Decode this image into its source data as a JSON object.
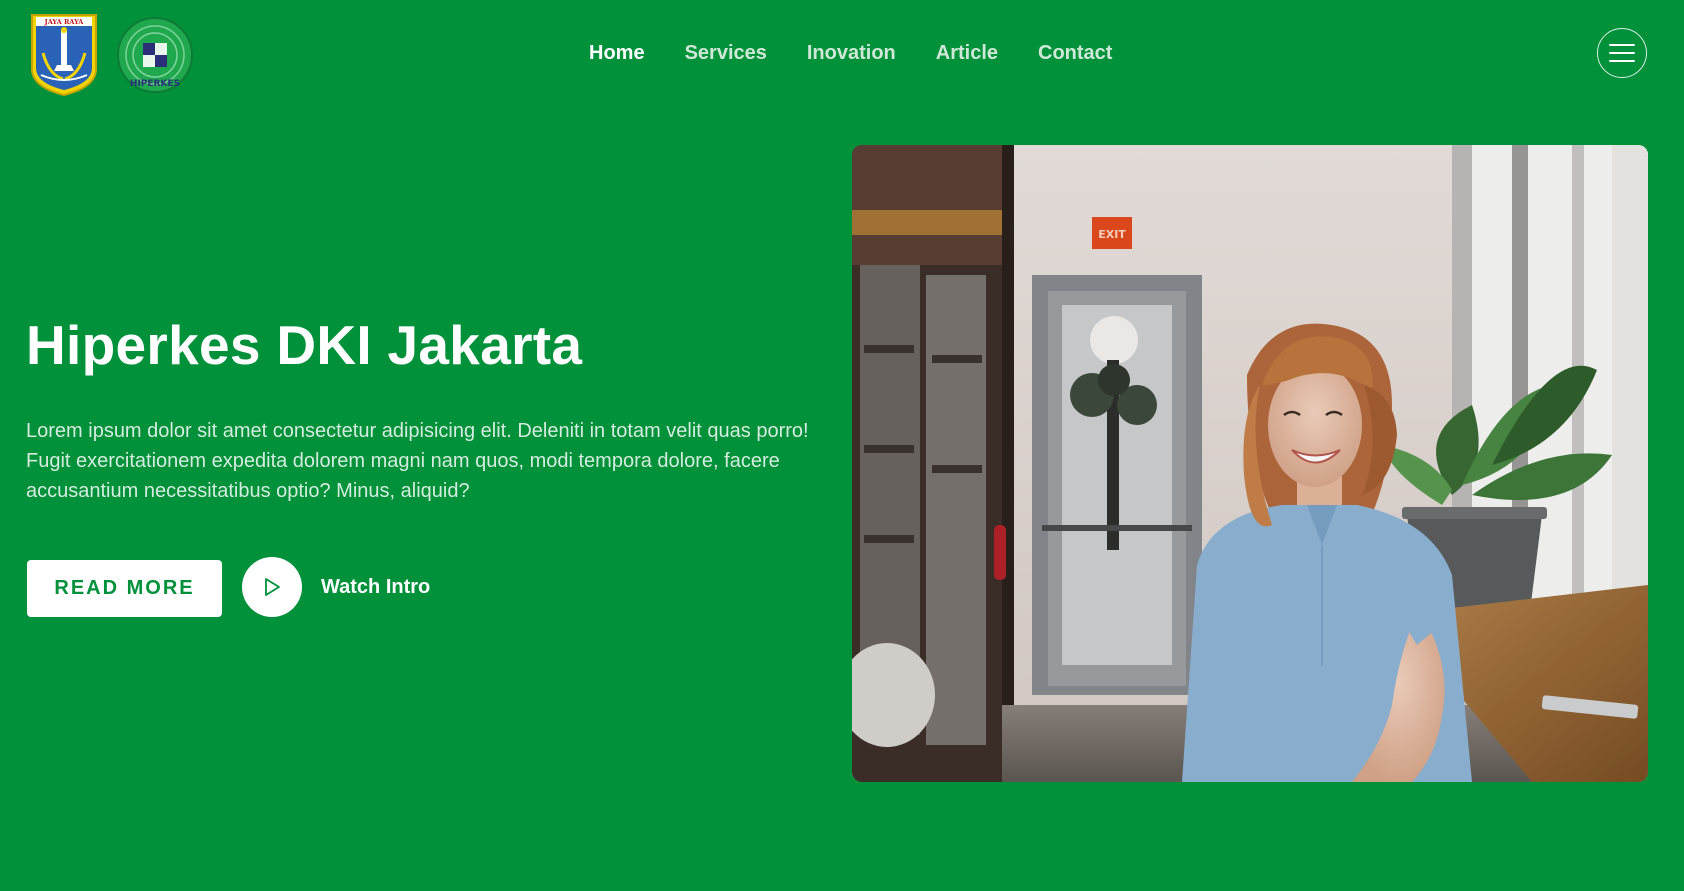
{
  "header": {
    "logos": [
      {
        "name": "jakarta-crest",
        "text": "JAYA RAYA"
      },
      {
        "name": "hiperkes-logo",
        "text": "HIPERKES"
      }
    ],
    "nav": [
      {
        "label": "Home",
        "active": true
      },
      {
        "label": "Services",
        "active": false
      },
      {
        "label": "Inovation",
        "active": false
      },
      {
        "label": "Article",
        "active": false
      },
      {
        "label": "Contact",
        "active": false
      }
    ],
    "menu_icon": "hamburger-icon"
  },
  "hero": {
    "title": "Hiperkes DKI Jakarta",
    "description": "Lorem ipsum dolor sit amet consectetur adipisicing elit. Deleniti in totam velit quas porro! Fugit exercitationem expedita dolorem magni nam quos, modi tempora dolore, facere accusantium necessitatibus optio? Minus, aliquid?",
    "read_more_label": "READ MORE",
    "watch_label": "Watch Intro",
    "play_icon": "play-icon",
    "photo_exit_sign": "EXIT"
  },
  "colors": {
    "brand_green": "#00913a",
    "text_white": "#ffffff",
    "nav_inactive": "#cfe8d6"
  }
}
